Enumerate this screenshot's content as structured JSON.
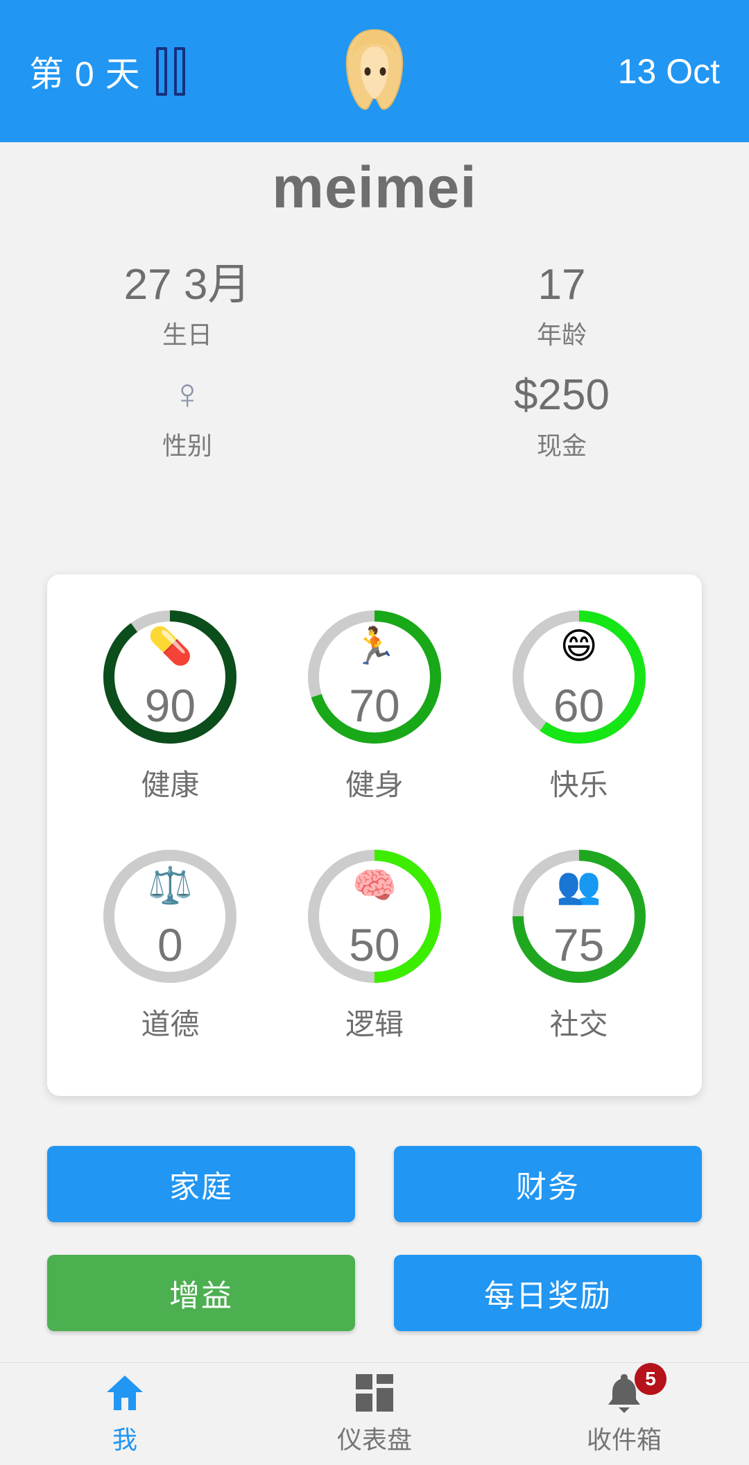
{
  "header": {
    "day_label": "第 0 天",
    "pause_icon": "pause-icon",
    "avatar_icon": "👱‍♀️",
    "date": "13 Oct"
  },
  "profile": {
    "name": "meimei",
    "stats": [
      {
        "value": "27 3月",
        "label": "生日",
        "type": "text"
      },
      {
        "value": "17",
        "label": "年龄",
        "type": "text"
      },
      {
        "value": "♀",
        "label": "性别",
        "type": "glyph"
      },
      {
        "value": "$250",
        "label": "现金",
        "type": "text"
      }
    ]
  },
  "gauges": {
    "track_color": "#cccccc",
    "items": [
      {
        "label": "健康",
        "value": 90,
        "emoji": "💊",
        "color": "#0b4d1b",
        "icon_name": "pill-icon"
      },
      {
        "label": "健身",
        "value": 70,
        "emoji": "🏃",
        "color": "#18a818",
        "icon_name": "running-icon"
      },
      {
        "label": "快乐",
        "value": 60,
        "emoji": "😄",
        "color": "#16e616",
        "icon_name": "smiley-icon"
      },
      {
        "label": "道德",
        "value": 0,
        "emoji": "⚖️",
        "color": "#cccccc",
        "icon_name": "scales-icon"
      },
      {
        "label": "逻辑",
        "value": 50,
        "emoji": "🧠",
        "color": "#3ced00",
        "icon_name": "brain-icon"
      },
      {
        "label": "社交",
        "value": 75,
        "emoji": "👥",
        "color": "#1fa81f",
        "icon_name": "people-icon"
      }
    ]
  },
  "actions": {
    "family": "家庭",
    "finance": "财务",
    "boost": "增益",
    "daily_reward": "每日奖励"
  },
  "bottom_nav": {
    "items": [
      {
        "label": "我",
        "icon": "home-icon",
        "active": true,
        "badge": ""
      },
      {
        "label": "仪表盘",
        "icon": "dashboard-icon",
        "active": false,
        "badge": ""
      },
      {
        "label": "收件箱",
        "icon": "bell-icon",
        "active": false,
        "badge": "5"
      }
    ]
  },
  "colors": {
    "primary": "#2196f3",
    "green": "#4caf50",
    "badge_red": "#b5121b",
    "background": "#f2f2f2",
    "text_gray": "#6e6e6e"
  }
}
